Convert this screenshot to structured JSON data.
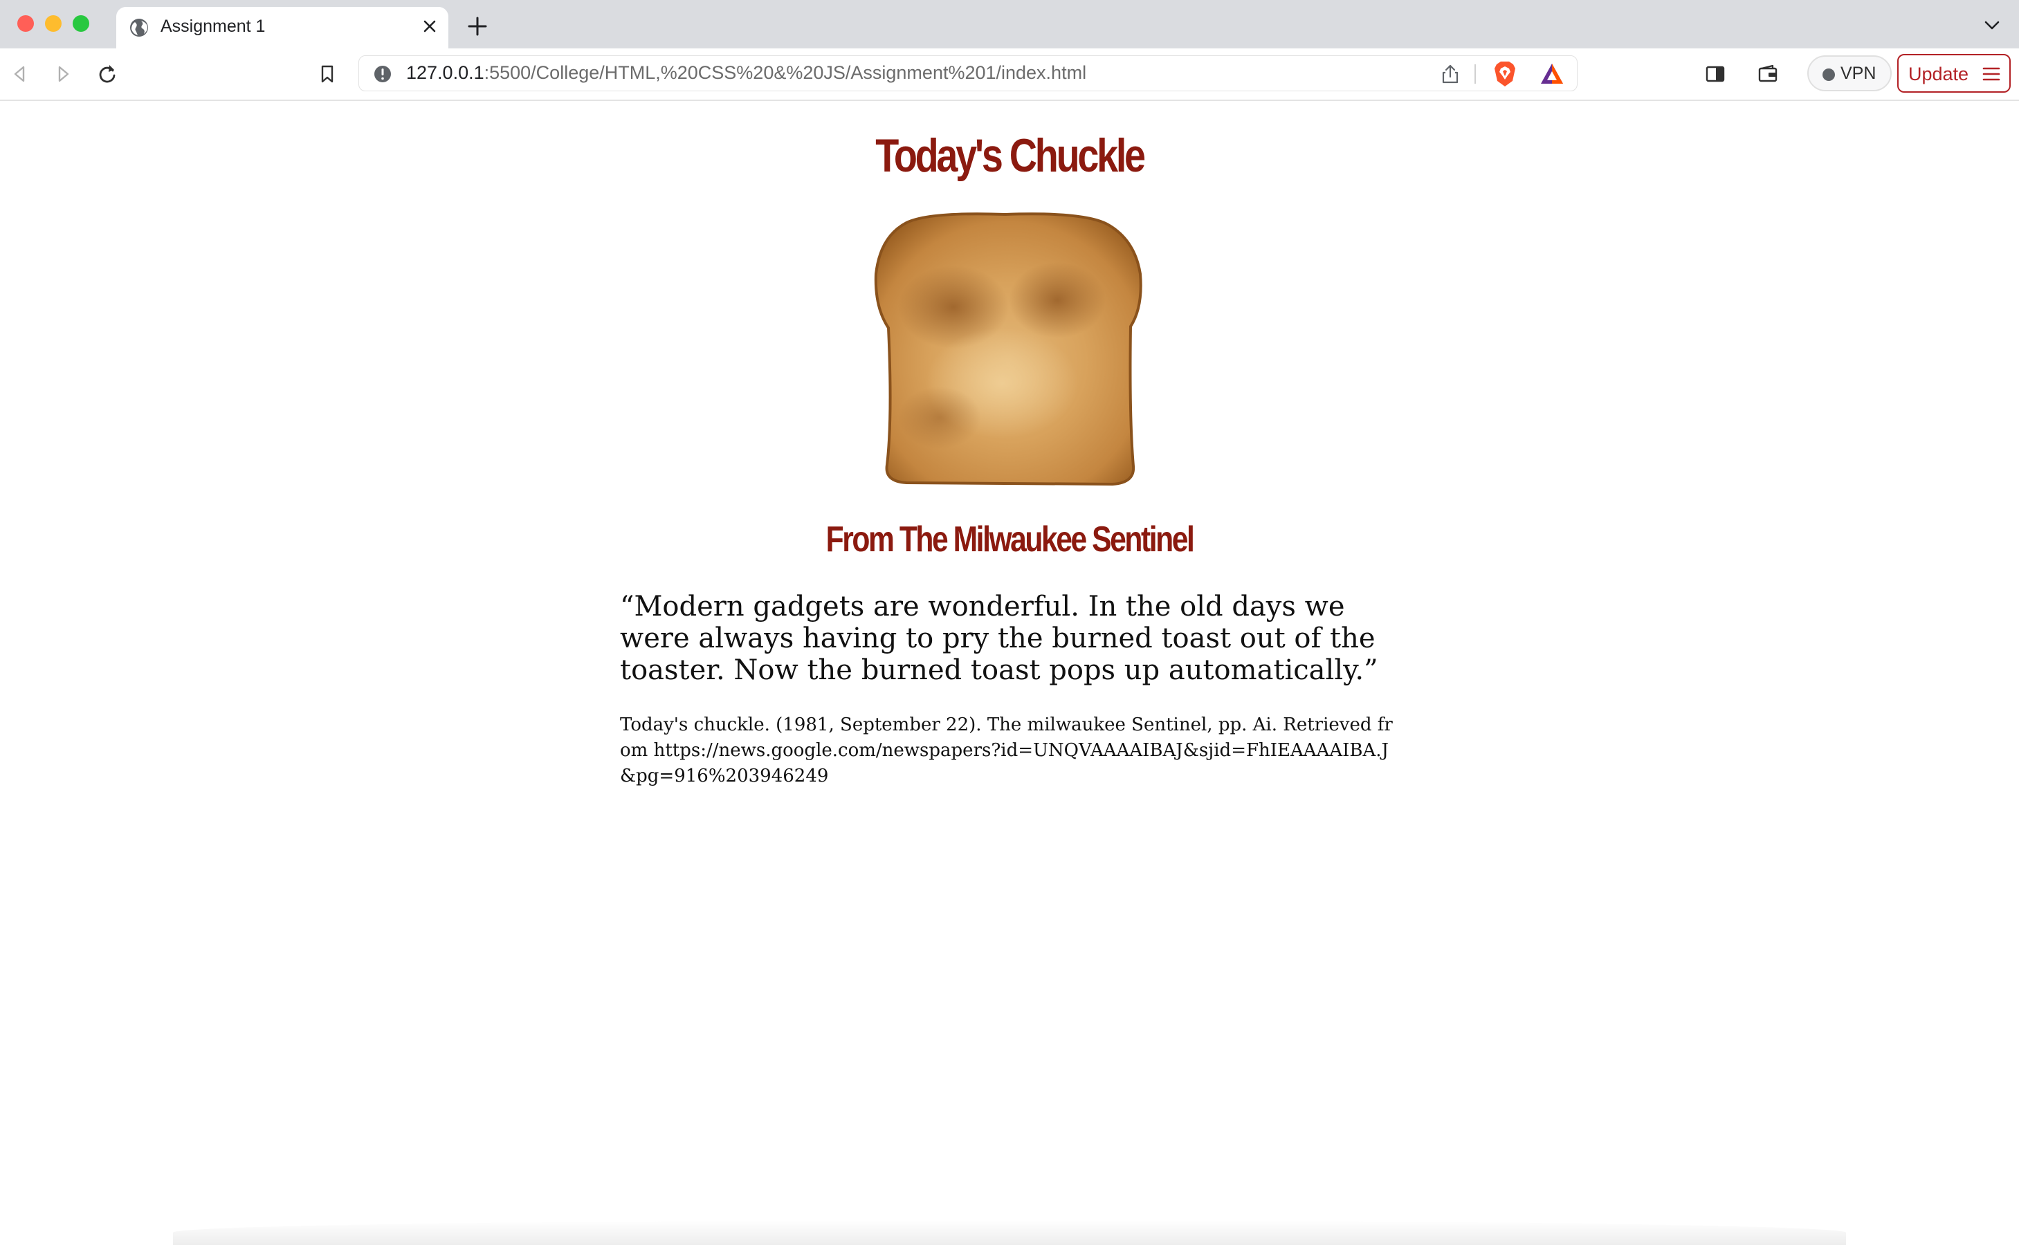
{
  "browser": {
    "tab": {
      "title": "Assignment 1"
    },
    "address": {
      "host": "127.0.0.1",
      "path": ":5500/College/HTML,%20CSS%20&%20JS/Assignment%201/index.html"
    },
    "vpn_label": "VPN",
    "update_label": "Update",
    "colors": {
      "update_accent": "#b32226",
      "tab_strip": "#dadce0"
    }
  },
  "page": {
    "title": "Today's Chuckle",
    "image_alt": "toast",
    "subtitle": "From The Milwaukee Sentinel",
    "quote": "“Modern gadgets are wonderful. In the old days we were always having to pry the burned toast out of the toaster. Now the burned toast pops up automatically.”",
    "citation": "Today's chuckle. (1981, September 22). The milwaukee Sentinel, pp. Ai. Retrieved from https://news.google.com/newspapers?id=UNQVAAAAIBAJ&sjid=FhIEAAAAIBA.J&pg=916%203946249",
    "colors": {
      "heading": "#8b1a0f"
    }
  }
}
